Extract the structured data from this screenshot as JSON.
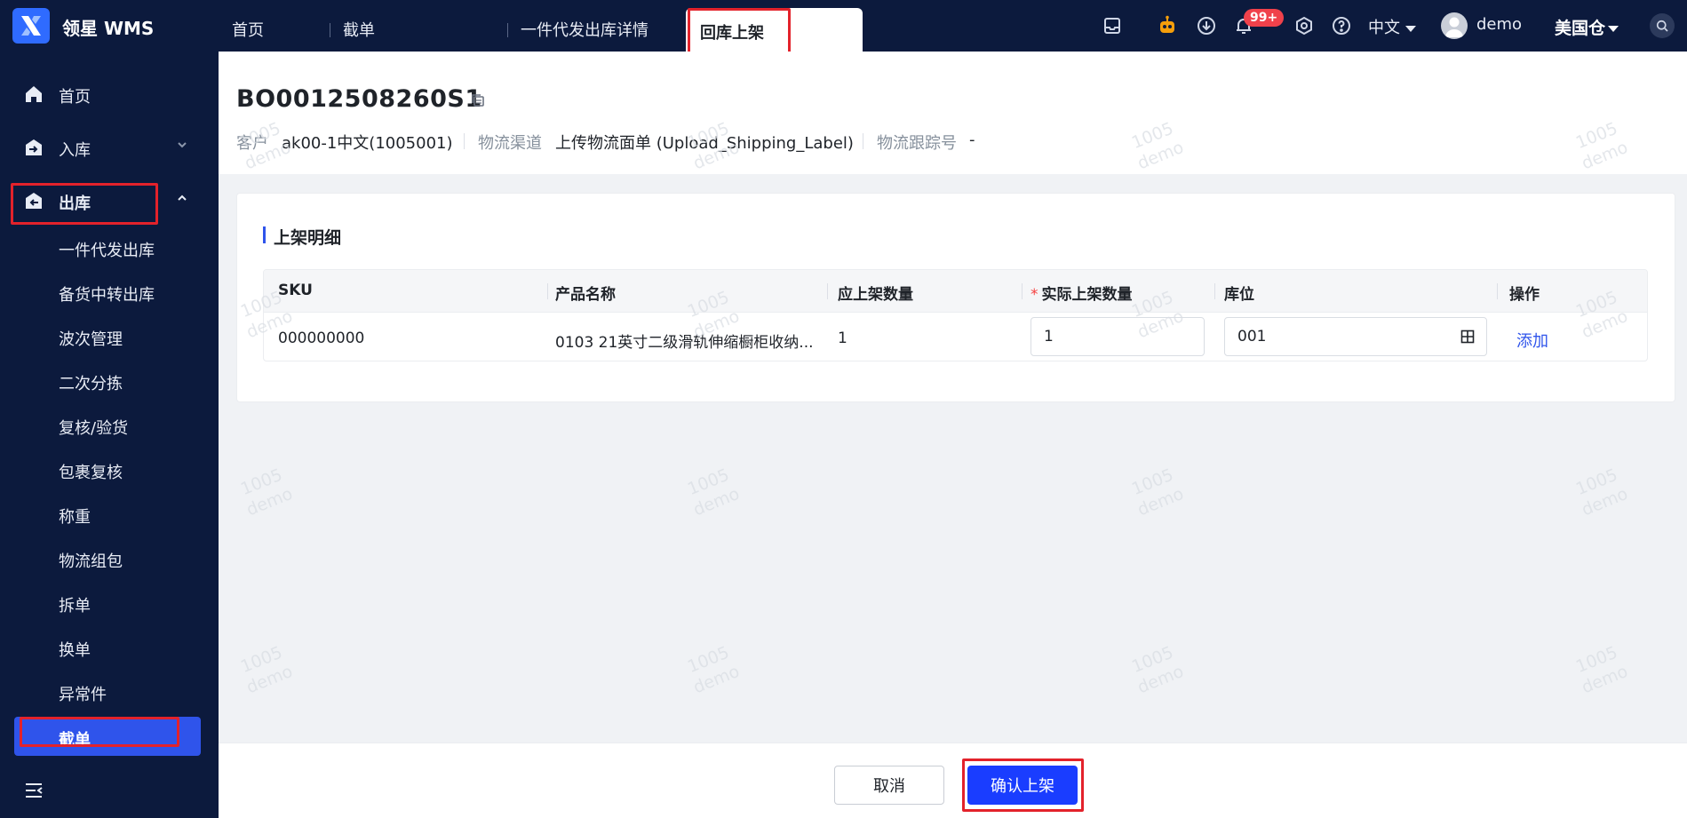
{
  "app": {
    "brand": "领星 WMS"
  },
  "tabs": [
    {
      "label": "首页"
    },
    {
      "label": "截单"
    },
    {
      "label": "一件代发出库详情"
    },
    {
      "label": "回库上架",
      "active": true
    }
  ],
  "topbar": {
    "notification_badge": "99+",
    "language": "中文",
    "user": "demo",
    "warehouse": "美国仓",
    "icons": [
      "inbox-icon",
      "robot-icon",
      "download-icon",
      "bell-icon",
      "settings-icon",
      "help-icon",
      "search-icon"
    ]
  },
  "sidebar": {
    "items": [
      {
        "label": "首页",
        "icon": "home-icon"
      },
      {
        "label": "入库",
        "icon": "inbound-icon"
      },
      {
        "label": "出库",
        "icon": "outbound-icon",
        "expanded": true
      }
    ],
    "sub_items": [
      "一件代发出库",
      "备货中转出库",
      "波次管理",
      "二次分拣",
      "复核/验货",
      "包裹复核",
      "称重",
      "物流组包",
      "拆单",
      "换单",
      "异常件"
    ],
    "active_sub_item": "截单"
  },
  "order": {
    "number": "BO0012508260S1",
    "customer_label": "客户",
    "customer_value": "ak00-1中文(1005001)",
    "channel_label": "物流渠道",
    "channel_value": "上传物流面单 (Upload_Shipping_Label)",
    "tracking_label": "物流跟踪号",
    "tracking_value": "-"
  },
  "section": {
    "title": "上架明细",
    "columns": [
      "SKU",
      "产品名称",
      "应上架数量",
      "实际上架数量",
      "库位",
      "操作"
    ],
    "rows": [
      {
        "sku": "000000000",
        "product_name": "0103 21英寸二级滑轨伸缩橱柜收纳...",
        "expected_qty": "1",
        "actual_qty": "1",
        "location": "001",
        "action": "添加"
      }
    ]
  },
  "watermark": {
    "line1": "1005",
    "line2": "demo"
  },
  "footer": {
    "cancel_label": "取消",
    "confirm_label": "确认上架"
  }
}
